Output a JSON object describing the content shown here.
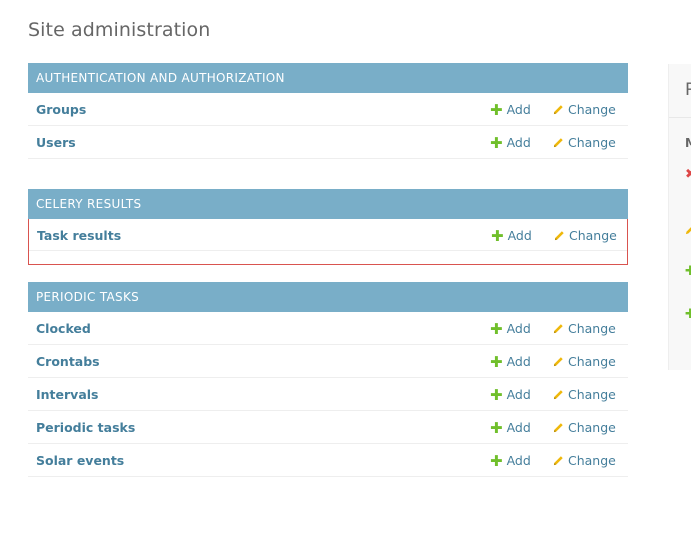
{
  "page": {
    "title": "Site administration"
  },
  "modules": [
    {
      "name": "AUTHENTICATION AND AUTHORIZATION",
      "rows": [
        {
          "label": "Groups",
          "add": "Add",
          "change": "Change"
        },
        {
          "label": "Users",
          "add": "Add",
          "change": "Change"
        }
      ]
    },
    {
      "name": "CELERY RESULTS",
      "rows": [
        {
          "label": "Task results",
          "add": "Add",
          "change": "Change"
        }
      ]
    },
    {
      "name": "PERIODIC TASKS",
      "rows": [
        {
          "label": "Clocked",
          "add": "Add",
          "change": "Change"
        },
        {
          "label": "Crontabs",
          "add": "Add",
          "change": "Change"
        },
        {
          "label": "Intervals",
          "add": "Add",
          "change": "Change"
        },
        {
          "label": "Periodic tasks",
          "add": "Add",
          "change": "Change"
        },
        {
          "label": "Solar events",
          "add": "Add",
          "change": "Change"
        }
      ]
    }
  ],
  "side_panel": {
    "heading": "R",
    "subheading": "M",
    "icons": [
      "delete-icon",
      "change-icon",
      "add-icon",
      "add-icon"
    ]
  },
  "colors": {
    "header_bg": "#79aec8",
    "link": "#447e9b",
    "add_icon": "#70bf2b",
    "change_icon": "#efb80b",
    "delete_icon": "#dd4646",
    "selection_border": "#d9534f",
    "title": "#666666"
  }
}
